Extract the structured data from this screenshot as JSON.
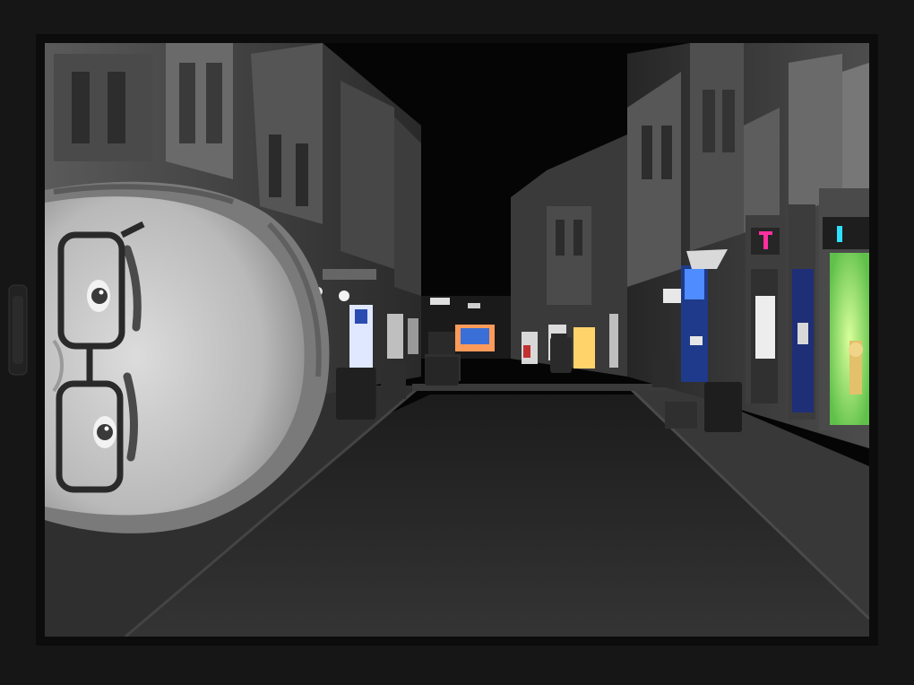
{
  "scene": {
    "subject": "photo-window-frame",
    "storefront_sign_text": "",
    "colors": {
      "frame": "#161616",
      "frame_inner": "#0e0e0e",
      "sky": "#050505",
      "street": "#2a2a2a",
      "sidewalk": "#3a3a3a",
      "building_light": "#6f6f6f",
      "building_dark": "#3c3c3c",
      "shop_green": "#7fdc5a",
      "shop_blue": "#1f3a8a",
      "shop_warm": "#ffd36a",
      "magenta_sign": "#ff2fa0",
      "cyan_sign": "#2fe0ff"
    }
  }
}
